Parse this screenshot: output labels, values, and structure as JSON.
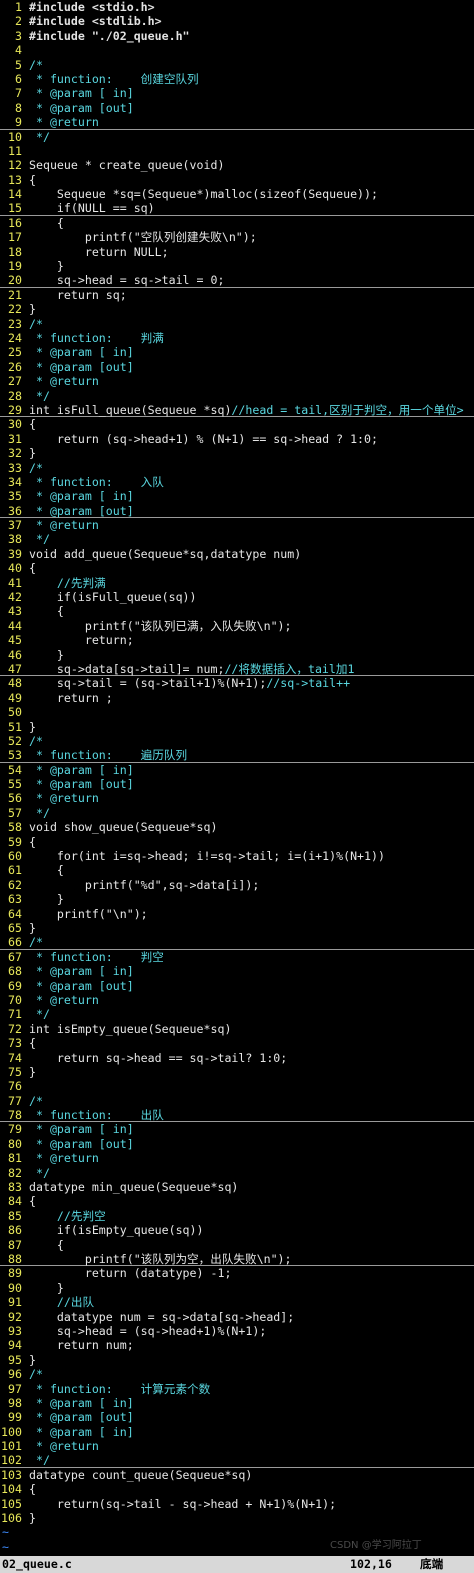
{
  "editor": {
    "lines": [
      "#include <stdio.h>",
      "#include <stdlib.h>",
      "#include \"./02_queue.h\"",
      "",
      "/*",
      " * function:    创建空队列",
      " * @param [ in]",
      " * @param [out]",
      " * @return",
      " */",
      "",
      "Sequeue * create_queue(void)",
      "{",
      "    Sequeue *sq=(Sequeue*)malloc(sizeof(Sequeue));",
      "    if(NULL == sq)",
      "    {",
      "        printf(\"空队列创建失败\\n\");",
      "        return NULL;",
      "    }",
      "    sq->head = sq->tail = 0;",
      "    return sq;",
      "}",
      "/*",
      " * function:    判满",
      " * @param [ in]",
      " * @param [out]",
      " * @return",
      " */",
      "int isFull_queue(Sequeue *sq)//head = tail,区别于判空，用一个单位>",
      "{",
      "    return (sq->head+1) % (N+1) == sq->head ? 1:0;",
      "}",
      "/*",
      " * function:    入队",
      " * @param [ in]",
      " * @param [out]",
      " * @return",
      " */",
      "void add_queue(Sequeue*sq,datatype num)",
      "{",
      "    //先判满",
      "    if(isFull_queue(sq))",
      "    {",
      "        printf(\"该队列已满，入队失败\\n\");",
      "        return;",
      "    }",
      "    sq->data[sq->tail]= num;//将数据插入，tail加1",
      "    sq->tail = (sq->tail+1)%(N+1);//sq->tail++",
      "    return ;",
      "",
      "}",
      "/*",
      " * function:    遍历队列",
      " * @param [ in]",
      " * @param [out]",
      " * @return",
      " */",
      "void show_queue(Sequeue*sq)",
      "{",
      "    for(int i=sq->head; i!=sq->tail; i=(i+1)%(N+1))",
      "    {",
      "        printf(\"%d\",sq->data[i]);",
      "    }",
      "    printf(\"\\n\");",
      "}",
      "/*",
      " * function:    判空",
      " * @param [ in]",
      " * @param [out]",
      " * @return",
      " */",
      "int isEmpty_queue(Sequeue*sq)",
      "{",
      "    return sq->head == sq->tail? 1:0;",
      "}",
      "",
      "/*",
      " * function:    出队",
      " * @param [ in]",
      " * @param [out]",
      " * @return",
      " */",
      "datatype min_queue(Sequeue*sq)",
      "{",
      "    //先判空",
      "    if(isEmpty_queue(sq))",
      "    {",
      "        printf(\"该队列为空，出队失败\\n\");",
      "        return (datatype) -1;",
      "    }",
      "    //出队",
      "    datatype num = sq->data[sq->head];",
      "    sq->head = (sq->head+1)%(N+1);",
      "    return num;",
      "}",
      "/*",
      " * function:    计算元素个数",
      " * @param [ in]",
      " * @param [out]",
      " * @param [ in]",
      " * @return",
      " */",
      "datatype count_queue(Sequeue*sq)",
      "{",
      "    return(sq->tail - sq->head + N+1)%(N+1);",
      "}"
    ],
    "tilde_lines": [
      "~",
      "~",
      "~"
    ]
  },
  "statusbar": {
    "filename": "02_queue.c",
    "position": "102,16",
    "percent": "底端"
  },
  "watermark": "CSDN @学习阿拉丁",
  "colors": {
    "background": "#000000",
    "line_number": "#e8e85a",
    "comment": "#5ad7e0",
    "tilde": "#3e8cff",
    "statusbar_bg": "#d8d8d8"
  }
}
